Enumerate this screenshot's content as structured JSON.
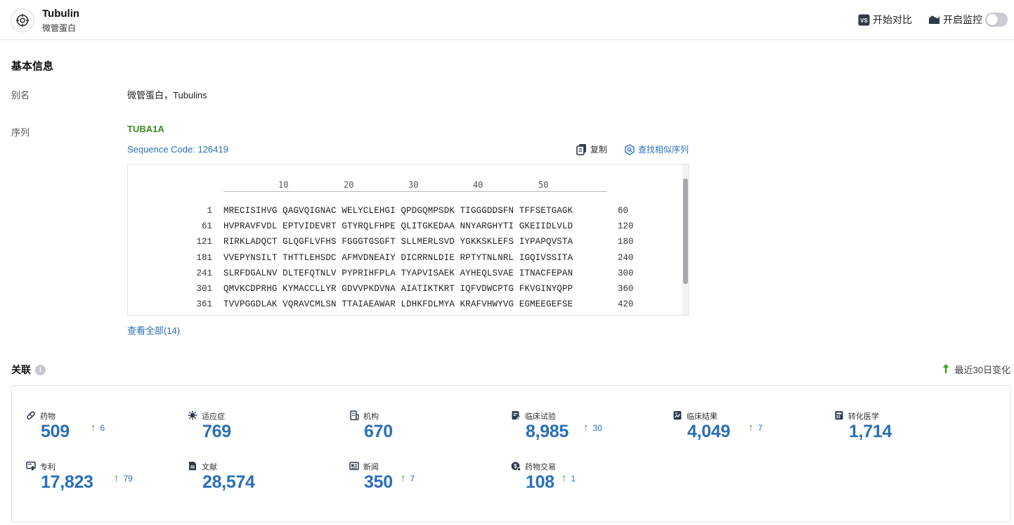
{
  "header": {
    "title": "Tubulin",
    "subtitle": "微管蛋白",
    "compare_label": "开始对比",
    "compare_badge": "VS",
    "monitor_label": "开启监控",
    "monitor_on": false
  },
  "basic": {
    "section_title": "基本信息",
    "alias_label": "别名",
    "alias_value": "微管蛋白，Tubulins",
    "sequence_label": "序列",
    "gene_name": "TUBA1A",
    "sequence_code": "Sequence Code: 126419",
    "copy_label": "复制",
    "find_similar_label": "查找相似序列",
    "ruler": [
      "10",
      "20",
      "30",
      "40",
      "50"
    ],
    "rows": [
      {
        "start": "1",
        "seq": "MRECISIHVG QAGVQIGNAC WELYCLEHGI QPDGQMPSDK TIGGGDDSFN TFFSETGAGK",
        "end": "60"
      },
      {
        "start": "61",
        "seq": "HVPRAVFVDL EPTVIDEVRT GTYRQLFHPE QLITGKEDAA NNYARGHYTI GKEIIDLVLD",
        "end": "120"
      },
      {
        "start": "121",
        "seq": "RIRKLADQCT GLQGFLVFHS FGGGTGSGFT SLLMERLSVD YGKKSKLEFS IYPAPQVSTA",
        "end": "180"
      },
      {
        "start": "181",
        "seq": "VVEPYNSILT THTTLEHSDC AFMVDNEAIY DICRRNLDIE RPTYTNLNRL IGQIVSSITA",
        "end": "240"
      },
      {
        "start": "241",
        "seq": "SLRFDGALNV DLTEFQTNLV PYPRIHFPLA TYAPVISAEK AYHEQLSVAE ITNACFEPAN",
        "end": "300"
      },
      {
        "start": "301",
        "seq": "QMVKCDPRHG KYMACCLLYR GDVVPKDVNA AIATIKTKRT IQFVDWCPTG FKVGINYQPP",
        "end": "360"
      },
      {
        "start": "361",
        "seq": "TVVPGGDLAK VQRAVCMLSN TTAIAEAWAR LDHKFDLMYA KRAFVHWYVG EGMEEGEFSE",
        "end": "420"
      }
    ],
    "view_all": "查看全部(14)"
  },
  "relations": {
    "title": "关联",
    "recent_label": "最近30日变化",
    "items": [
      {
        "name": "drugs",
        "label": "药物",
        "value": "509",
        "delta": "6",
        "icon": "pill-icon"
      },
      {
        "name": "indications",
        "label": "适应症",
        "value": "769",
        "delta": "",
        "icon": "virus-icon"
      },
      {
        "name": "organizations",
        "label": "机构",
        "value": "670",
        "delta": "",
        "icon": "building-icon"
      },
      {
        "name": "clinical-trials",
        "label": "临床试验",
        "value": "8,985",
        "delta": "30",
        "icon": "clipboard-icon"
      },
      {
        "name": "clinical-results",
        "label": "临床结果",
        "value": "4,049",
        "delta": "7",
        "icon": "chart-doc-icon"
      },
      {
        "name": "translational",
        "label": "转化医学",
        "value": "1,714",
        "delta": "",
        "icon": "calculator-icon"
      },
      {
        "name": "patents",
        "label": "专利",
        "value": "17,823",
        "delta": "79",
        "icon": "certificate-icon"
      },
      {
        "name": "literature",
        "label": "文献",
        "value": "28,574",
        "delta": "",
        "icon": "document-icon"
      },
      {
        "name": "news",
        "label": "新闻",
        "value": "350",
        "delta": "7",
        "icon": "newspaper-icon"
      },
      {
        "name": "deals",
        "label": "药物交易",
        "value": "108",
        "delta": "1",
        "icon": "deal-icon"
      }
    ]
  },
  "colors": {
    "link_blue": "#2a6fb8",
    "gene_green": "#3c8c1f",
    "up_green": "#3c9a2a"
  }
}
